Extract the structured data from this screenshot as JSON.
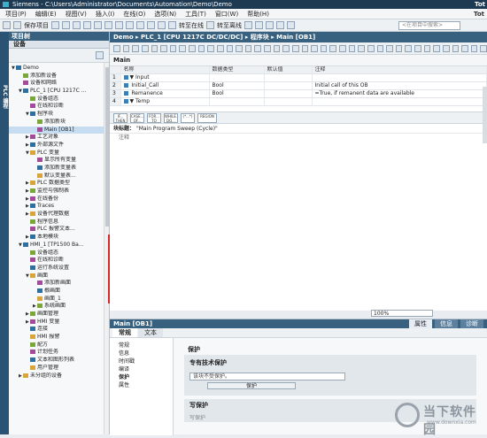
{
  "window": {
    "title": "Siemens - C:\\Users\\Administrator\\Documents\\Automation\\Demo\\Demo",
    "brand": "Tot"
  },
  "menu": [
    "项目(P)",
    "编辑(E)",
    "视图(V)",
    "插入(I)",
    "在线(O)",
    "选项(N)",
    "工具(T)",
    "窗口(W)",
    "帮助(H)"
  ],
  "menu_right": "Tot",
  "toolbar": {
    "save_label": "保存项目",
    "online_label": "转至在线",
    "offline_label": "转至离线",
    "search_placeholder": "<在项目中搜索>"
  },
  "sidebar_tab": "PLC 编程",
  "project_tree": {
    "header": "项目树",
    "sub": "设备",
    "nodes": [
      {
        "label": "Demo",
        "level": 0,
        "arrow": "▼"
      },
      {
        "label": "添加新设备",
        "level": 1,
        "arrow": ""
      },
      {
        "label": "设备和网络",
        "level": 1,
        "arrow": ""
      },
      {
        "label": "PLC_1 [CPU 1217C ...",
        "level": 1,
        "arrow": "▼"
      },
      {
        "label": "设备组态",
        "level": 2,
        "arrow": ""
      },
      {
        "label": "在线和诊断",
        "level": 2,
        "arrow": ""
      },
      {
        "label": "程序块",
        "level": 2,
        "arrow": "▼"
      },
      {
        "label": "添加新块",
        "level": 3,
        "arrow": ""
      },
      {
        "label": "Main [OB1]",
        "level": 3,
        "arrow": "",
        "selected": true
      },
      {
        "label": "工艺对象",
        "level": 2,
        "arrow": "▶"
      },
      {
        "label": "外部源文件",
        "level": 2,
        "arrow": "▶"
      },
      {
        "label": "PLC 变量",
        "level": 2,
        "arrow": "▼"
      },
      {
        "label": "显示所有变量",
        "level": 3,
        "arrow": ""
      },
      {
        "label": "添加新变量表",
        "level": 3,
        "arrow": ""
      },
      {
        "label": "默认变量表...",
        "level": 3,
        "arrow": ""
      },
      {
        "label": "PLC 数据类型",
        "level": 2,
        "arrow": "▶"
      },
      {
        "label": "监控与强制表",
        "level": 2,
        "arrow": "▶"
      },
      {
        "label": "在线备份",
        "level": 2,
        "arrow": "▶"
      },
      {
        "label": "Traces",
        "level": 2,
        "arrow": "▶"
      },
      {
        "label": "设备代理数据",
        "level": 2,
        "arrow": "▶"
      },
      {
        "label": "程序信息",
        "level": 2,
        "arrow": ""
      },
      {
        "label": "PLC 报警文本...",
        "level": 2,
        "arrow": ""
      },
      {
        "label": "本地模块",
        "level": 2,
        "arrow": "▶"
      },
      {
        "label": "HMI_1 [TP1500 Ba...",
        "level": 1,
        "arrow": "▼"
      },
      {
        "label": "设备组态",
        "level": 2,
        "arrow": ""
      },
      {
        "label": "在线和诊断",
        "level": 2,
        "arrow": ""
      },
      {
        "label": "运行系统设置",
        "level": 2,
        "arrow": ""
      },
      {
        "label": "画面",
        "level": 2,
        "arrow": "▼"
      },
      {
        "label": "添加新画面",
        "level": 3,
        "arrow": ""
      },
      {
        "label": "根画面",
        "level": 3,
        "arrow": ""
      },
      {
        "label": "画面_1",
        "level": 3,
        "arrow": ""
      },
      {
        "label": "系统画面",
        "level": 3,
        "arrow": "▶"
      },
      {
        "label": "画面管理",
        "level": 2,
        "arrow": "▶"
      },
      {
        "label": "HMI 变量",
        "level": 2,
        "arrow": "▶"
      },
      {
        "label": "连接",
        "level": 2,
        "arrow": ""
      },
      {
        "label": "HMI 报警",
        "level": 2,
        "arrow": ""
      },
      {
        "label": "配方",
        "level": 2,
        "arrow": ""
      },
      {
        "label": "计划任务",
        "level": 2,
        "arrow": ""
      },
      {
        "label": "文本和图形列表",
        "level": 2,
        "arrow": ""
      },
      {
        "label": "用户管理",
        "level": 2,
        "arrow": ""
      },
      {
        "label": "未分组的设备",
        "level": 1,
        "arrow": "▶"
      }
    ]
  },
  "editor": {
    "breadcrumb": "Demo ▸ PLC_1 [CPU 1217C DC/DC/DC] ▸ 程序块 ▸ Main [OB1]",
    "block_name": "Main",
    "columns": [
      "名称",
      "数据类型",
      "默认值",
      "注释"
    ],
    "rows": [
      {
        "num": "1",
        "name": "▼ Input",
        "type": "",
        "default": "",
        "comment": ""
      },
      {
        "num": "2",
        "name": "    Initial_Call",
        "type": "Bool",
        "default": "",
        "comment": "Initial call of this OB"
      },
      {
        "num": "3",
        "name": "    Remanence",
        "type": "Bool",
        "default": "",
        "comment": "=True, if remanent data are available"
      },
      {
        "num": "4",
        "name": "▼ Temp",
        "type": "",
        "default": "",
        "comment": ""
      }
    ],
    "instr_buttons": [
      "IF... THEN",
      "CASE... OF...",
      "FOR... TO DO...",
      "WHILE... DO...",
      "(*...*)",
      "REGION"
    ],
    "segment_label": "块标题：",
    "segment_title": "\"Main Program Sweep (Cycle)\"",
    "comment_label": "注释",
    "zoom": "100%"
  },
  "properties": {
    "title": "Main [OB1]",
    "header_tabs": [
      "属性",
      "信息",
      "诊断"
    ],
    "tabs": [
      "常规",
      "文本"
    ],
    "left_items": [
      "常规",
      "信息",
      "时间戳",
      "编译",
      "保护",
      "属性"
    ],
    "section_title": "保护",
    "know_how_title": "专有技术保护",
    "know_how_field": "该块不受保护。",
    "protect_button": "保护",
    "write_title": "写保护",
    "write_option": "写保护"
  },
  "watermark": {
    "name": "当下软件园",
    "url": "www.downxia.com"
  }
}
